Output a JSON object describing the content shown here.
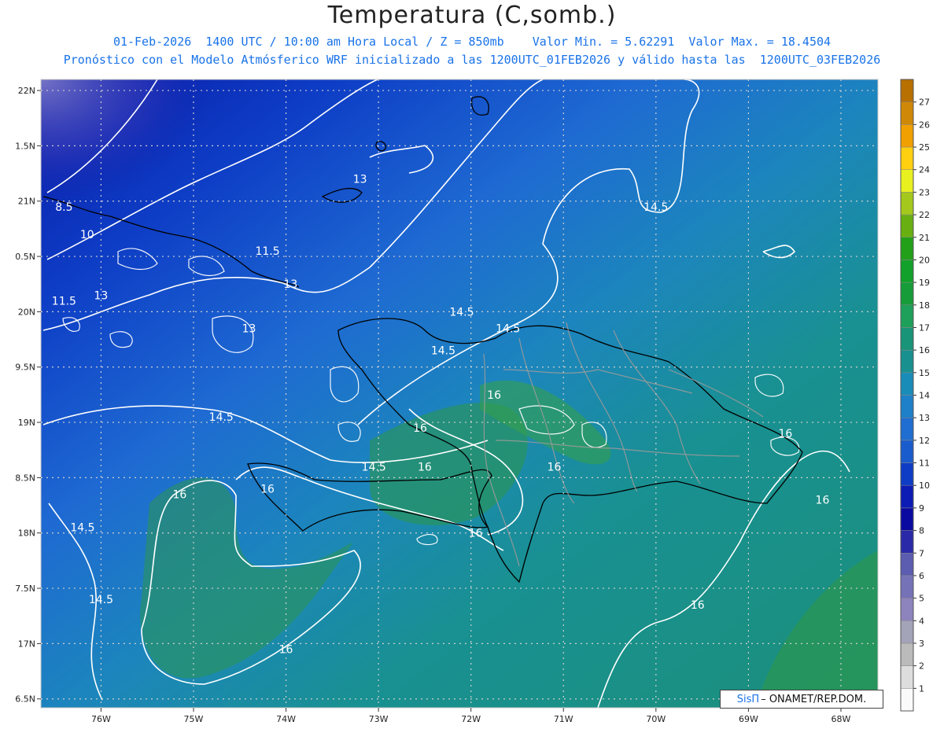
{
  "header": {
    "title": "Temperatura (C,somb.)",
    "line1": "01-Feb-2026  1400 UTC / 10:00 am Hora Local / Z = 850mb    Valor Min. = 5.62291  Valor Max. = 18.4504",
    "line2": "Pronóstico con el Modelo Atmósferico WRF inicializado a las 1200UTC_01FEB2026 y válido hasta las  1200UTC_03FEB2026"
  },
  "credit": {
    "brand": "SisΠ",
    "text": "– ONAMET/REP.DOM."
  },
  "chart_data": {
    "type": "heatmap",
    "x_ticks": [
      "76W",
      "75W",
      "74W",
      "73W",
      "72W",
      "71W",
      "70W",
      "69W",
      "68W"
    ],
    "x_values": [
      -76,
      -75,
      -74,
      -73,
      -72,
      -71,
      -70,
      -69,
      -68
    ],
    "y_ticks": [
      "22N",
      "1.5N",
      "21N",
      "0.5N",
      "20N",
      "9.5N",
      "19N",
      "8.5N",
      "18N",
      "7.5N",
      "17N",
      "6.5N"
    ],
    "y_values": [
      22,
      21.5,
      21,
      20.5,
      20,
      19.5,
      19,
      18.5,
      18,
      17.5,
      17,
      16.5
    ],
    "contour_labels": [
      {
        "text": "13",
        "lon": -73.2,
        "lat": 21.2
      },
      {
        "text": "14.5",
        "lon": -70.0,
        "lat": 20.95
      },
      {
        "text": "8.5",
        "lon": -76.4,
        "lat": 20.95
      },
      {
        "text": "10",
        "lon": -76.15,
        "lat": 20.7
      },
      {
        "text": "11.5",
        "lon": -74.2,
        "lat": 20.55
      },
      {
        "text": "13",
        "lon": -73.95,
        "lat": 20.25
      },
      {
        "text": "11.5",
        "lon": -76.4,
        "lat": 20.1
      },
      {
        "text": "13",
        "lon": -76.0,
        "lat": 20.15
      },
      {
        "text": "13",
        "lon": -74.4,
        "lat": 19.85
      },
      {
        "text": "14.5",
        "lon": -72.1,
        "lat": 20.0
      },
      {
        "text": "14.5",
        "lon": -71.6,
        "lat": 19.85
      },
      {
        "text": "14.5",
        "lon": -72.3,
        "lat": 19.65
      },
      {
        "text": "16",
        "lon": -71.75,
        "lat": 19.25
      },
      {
        "text": "14.5",
        "lon": -74.7,
        "lat": 19.05
      },
      {
        "text": "16",
        "lon": -72.55,
        "lat": 18.95
      },
      {
        "text": "16",
        "lon": -72.5,
        "lat": 18.6
      },
      {
        "text": "14.5",
        "lon": -73.05,
        "lat": 18.6
      },
      {
        "text": "16",
        "lon": -74.2,
        "lat": 18.4
      },
      {
        "text": "16",
        "lon": -75.15,
        "lat": 18.35
      },
      {
        "text": "16",
        "lon": -71.1,
        "lat": 18.6
      },
      {
        "text": "16",
        "lon": -68.6,
        "lat": 18.9
      },
      {
        "text": "16",
        "lon": -68.2,
        "lat": 18.3
      },
      {
        "text": "16",
        "lon": -71.95,
        "lat": 18.0
      },
      {
        "text": "14.5",
        "lon": -76.2,
        "lat": 18.05
      },
      {
        "text": "14.5",
        "lon": -76.0,
        "lat": 17.4
      },
      {
        "text": "16",
        "lon": -69.55,
        "lat": 17.35
      },
      {
        "text": "16",
        "lon": -74.0,
        "lat": 16.95
      }
    ],
    "colorbar": {
      "labels": [
        "1",
        "2",
        "3",
        "4",
        "5",
        "6",
        "7",
        "8",
        "9",
        "10",
        "11",
        "12",
        "13",
        "14",
        "15",
        "16",
        "17",
        "18",
        "19",
        "20",
        "21",
        "22",
        "23",
        "24",
        "25",
        "26",
        "27"
      ],
      "colors": [
        "#fafafa",
        "#dddddd",
        "#bbbbbb",
        "#a4a4b8",
        "#8e84bd",
        "#7672b8",
        "#5c5cb0",
        "#2a2aa8",
        "#0a0aa0",
        "#0c1cb4",
        "#0e3cc4",
        "#1a5ccc",
        "#1f6ed0",
        "#1d80c8",
        "#1a8cb8",
        "#18908f",
        "#1a9478",
        "#1ea05a",
        "#169d3a",
        "#12a12a",
        "#22a01a",
        "#68b012",
        "#a4c81c",
        "#e8f020",
        "#ffd010",
        "#f0a000",
        "#d08808",
        "#b87000"
      ],
      "range": [
        0,
        28
      ]
    },
    "land_color": "#2a8f4a",
    "sea_color": "#1c8a78",
    "value_range": [
      5.62291,
      18.4504
    ]
  }
}
